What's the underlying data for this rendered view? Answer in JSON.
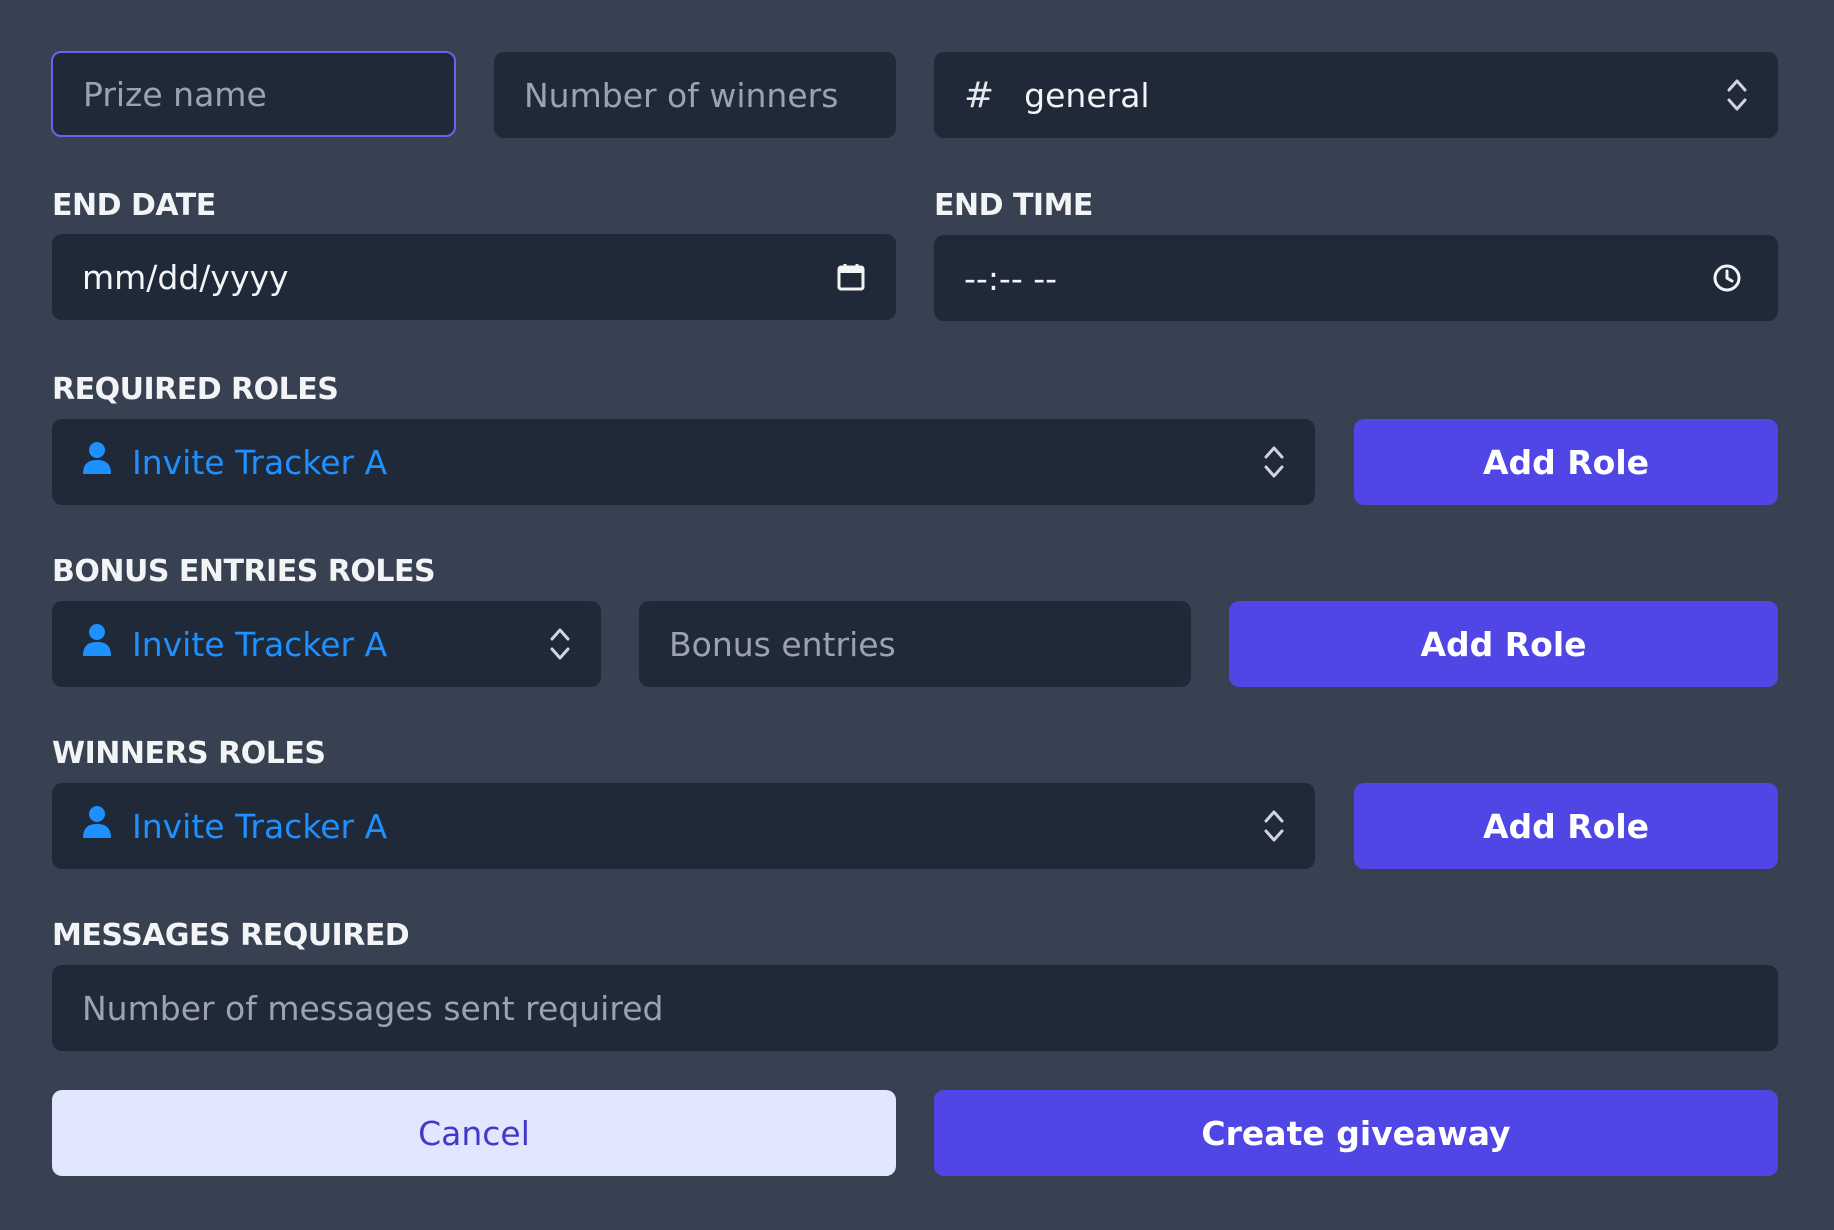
{
  "prize_name": {
    "placeholder": "Prize name"
  },
  "winners_count": {
    "placeholder": "Number of winners"
  },
  "channel": {
    "prefix": "#",
    "value": "general",
    "icon": "chevron-updown-icon"
  },
  "end_date": {
    "label": "END DATE",
    "value": "mm/dd/yyyy",
    "icon": "calendar-icon"
  },
  "end_time": {
    "label": "END TIME",
    "value": "--:-- --",
    "icon": "clock-icon"
  },
  "required_roles": {
    "label": "REQUIRED ROLES",
    "role": "Invite Tracker A",
    "button": "Add Role"
  },
  "bonus_roles": {
    "label": "BONUS ENTRIES ROLES",
    "role": "Invite Tracker A",
    "entries_placeholder": "Bonus entries",
    "button": "Add Role"
  },
  "winners_roles": {
    "label": "WINNERS ROLES",
    "role": "Invite Tracker A",
    "button": "Add Role"
  },
  "messages": {
    "label": "MESSAGES REQUIRED",
    "placeholder": "Number of messages sent required"
  },
  "actions": {
    "cancel": "Cancel",
    "create": "Create giveaway"
  },
  "colors": {
    "background": "#374151",
    "field": "#1f2937",
    "accent": "#4f46e5",
    "role_text": "#1e90ff",
    "cancel_bg": "#e0e7ff"
  }
}
